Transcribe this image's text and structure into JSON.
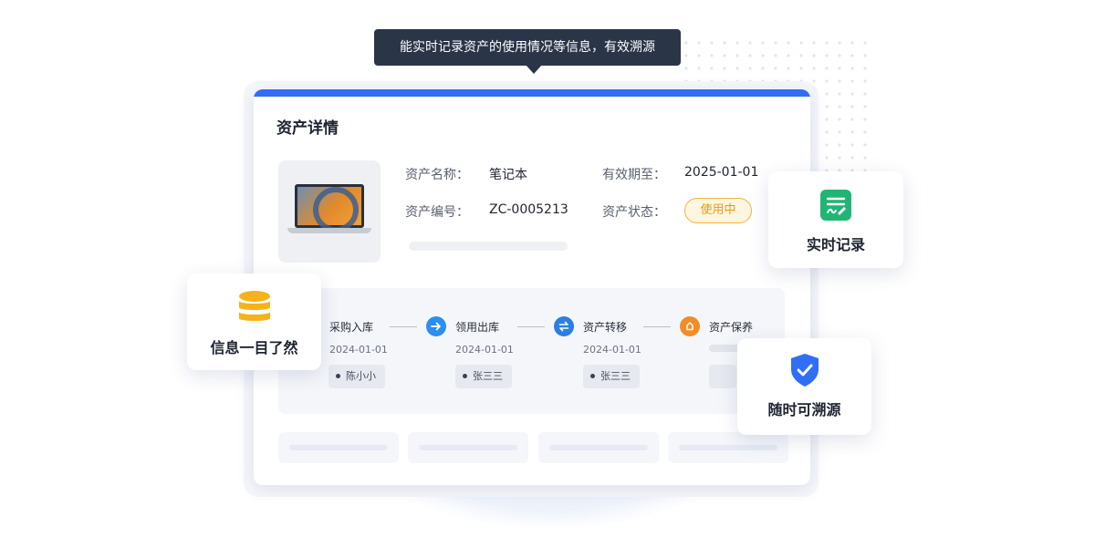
{
  "tooltip": {
    "text": "能实时记录资产的使用情况等信息，有效溯源"
  },
  "card": {
    "title": "资产详情",
    "asset_image_icon": "laptop-icon",
    "fields": {
      "name_label": "资产名称：",
      "name_value": "笔记本",
      "code_label": "资产编号：",
      "code_value": "ZC-0005213",
      "expiry_label": "有效期至：",
      "expiry_value": "2025-01-01",
      "status_label": "资产状态：",
      "status_value": "使用中"
    },
    "timeline": [
      {
        "label": "采购入库",
        "date": "2024-01-01",
        "person": "陈小小",
        "icon": "none"
      },
      {
        "label": "领用出库",
        "date": "2024-01-01",
        "person": "张三三",
        "icon": "arrow-right-icon",
        "color": "#2b8ef0"
      },
      {
        "label": "资产转移",
        "date": "2024-01-01",
        "person": "张三三",
        "icon": "transfer-icon",
        "color": "#2a7fe0"
      },
      {
        "label": "资产保养",
        "date": "",
        "person": "",
        "icon": "maintenance-icon",
        "color": "#f28c28"
      }
    ]
  },
  "floats": {
    "realtime": {
      "label": "实时记录",
      "icon": "edit-document-icon",
      "color": "#21b573"
    },
    "info": {
      "label": "信息一目了然",
      "icon": "database-icon",
      "color": "#f5b21b"
    },
    "trace": {
      "label": "随时可溯源",
      "icon": "shield-check-icon",
      "color": "#2f6ef5"
    }
  },
  "colors": {
    "accent": "#2f6ef5",
    "status": "#e59b13",
    "tooltip_bg": "#2b3548"
  }
}
